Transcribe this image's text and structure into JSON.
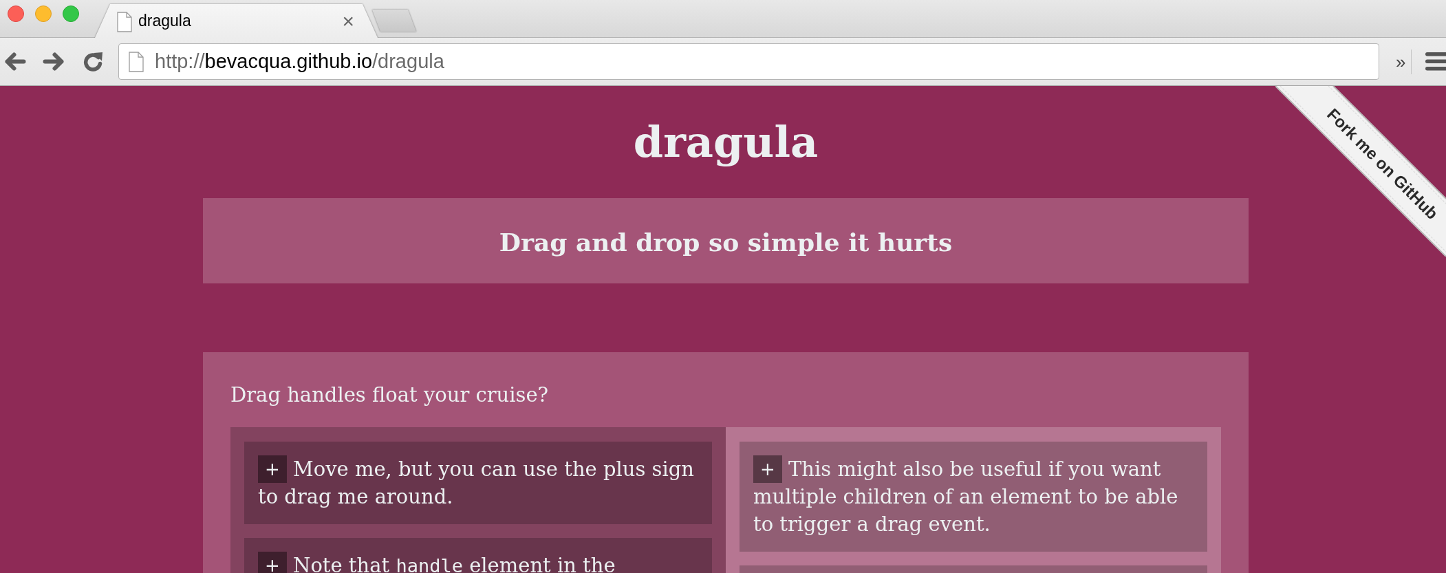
{
  "browser": {
    "tabs": [
      {
        "title": "dragula",
        "close": "×",
        "selected": true
      }
    ],
    "address_bar": {
      "scheme": "http://",
      "host": "bevacqua.github.io",
      "path": "/dragula"
    },
    "overflow_button": "»"
  },
  "page": {
    "title": "dragula",
    "tagline": "Drag and drop so simple it hurts",
    "fork_ribbon": "Fork me on GitHub",
    "example": {
      "heading": "Drag handles float your cruise?",
      "containers": [
        {
          "items": [
            {
              "kind": "item",
              "handle": "+",
              "runs": [
                {
                  "kind": "plain",
                  "text": "Move me, but you can use the plus sign to drag me around."
                }
              ]
            },
            {
              "kind": "item",
              "handle": "+",
              "runs": [
                {
                  "kind": "plain",
                  "text": "Note that "
                },
                {
                  "kind": "code",
                  "text": "handle"
                },
                {
                  "kind": "plain",
                  "text": " element in the"
                }
              ]
            }
          ]
        },
        {
          "items": [
            {
              "kind": "item",
              "handle": "+",
              "runs": [
                {
                  "kind": "plain",
                  "text": "This might also be useful if you want multiple children of an element to be able to trigger a drag event."
                }
              ]
            },
            {
              "kind": "clipped"
            }
          ]
        }
      ]
    }
  }
}
